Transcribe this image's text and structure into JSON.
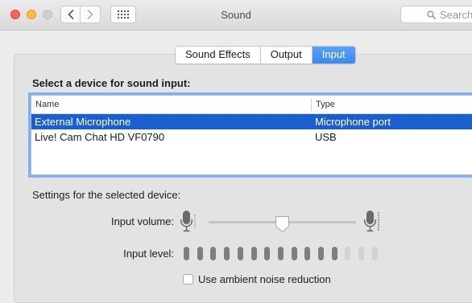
{
  "window": {
    "title": "Sound"
  },
  "toolbar": {
    "back_icon": "chevron-left-icon",
    "forward_icon": "chevron-right-icon",
    "grid_icon": "show-all-grid-icon",
    "search_placeholder": "Search",
    "search_icon": "search-icon"
  },
  "tabs": [
    {
      "label": "Sound Effects",
      "active": false
    },
    {
      "label": "Output",
      "active": false
    },
    {
      "label": "Input",
      "active": true
    }
  ],
  "input": {
    "heading": "Select a device for sound input:",
    "columns": {
      "name": "Name",
      "type": "Type"
    },
    "devices": [
      {
        "name": "External Microphone",
        "type": "Microphone port",
        "selected": true
      },
      {
        "name": "Live! Cam Chat HD VF0790",
        "type": "USB",
        "selected": false
      }
    ],
    "settings_heading": "Settings for the selected device:",
    "volume_label": "Input volume:",
    "volume_level": 0.5,
    "level_label": "Input level:",
    "level_segments_total": 15,
    "level_segments_lit": 12,
    "noise_reduction_label": "Use ambient noise reduction",
    "noise_reduction_checked": false
  },
  "colors": {
    "accent": "#3b87f0",
    "selection": "#1a5ecf",
    "meter_on": "#7e7e7e",
    "meter_off": "#d2d2d2"
  }
}
